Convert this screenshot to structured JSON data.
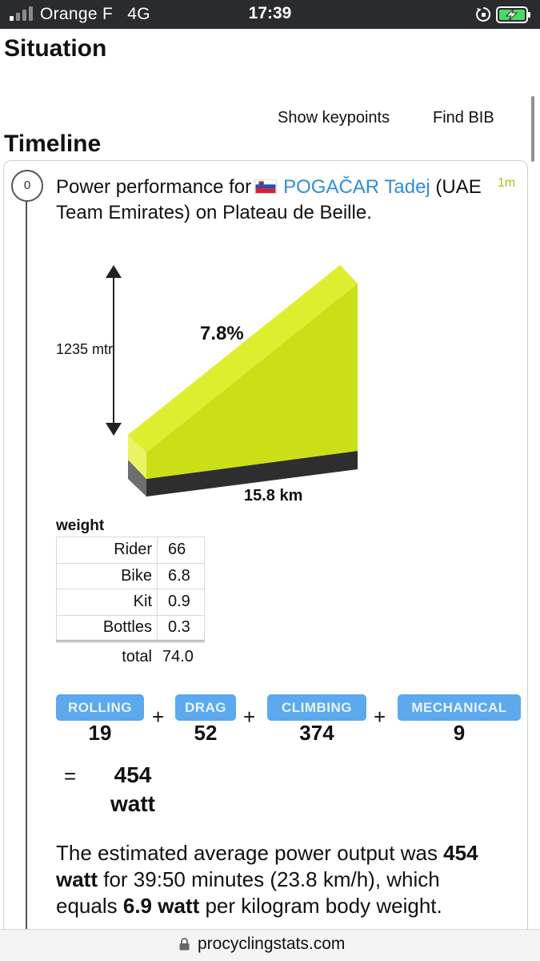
{
  "status_bar": {
    "carrier": "Orange F",
    "network": "4G",
    "time": "17:39",
    "signal_bars_on": 1,
    "signal_bars_total": 4,
    "battery_color": "#4cd964"
  },
  "page": {
    "section_title": "Situation",
    "links": {
      "show_keypoints": "Show keypoints",
      "find_bib": "Find BIB"
    },
    "timeline_title": "Timeline"
  },
  "timeline_entry": {
    "index": "0",
    "age": "1m",
    "intro_prefix": "Power performance for",
    "rider": "POGAČAR Tadej",
    "intro_suffix": "(UAE Team Emirates) on Plateau de Beille.",
    "flag": "slovenia-flag-icon",
    "climb": {
      "elevation_label": "1235 mtr",
      "gradient_label": "7.8%",
      "distance_label": "15.8 km",
      "colors": {
        "slope_top": "#ddee2e",
        "slope_side": "#cbdf16",
        "base": "#2e2e2e"
      }
    },
    "weight": {
      "heading": "weight",
      "rows": [
        {
          "label": "Rider",
          "value": "66"
        },
        {
          "label": "Bike",
          "value": "6.8"
        },
        {
          "label": "Kit",
          "value": "0.9"
        },
        {
          "label": "Bottles",
          "value": "0.3"
        }
      ],
      "total_label": "total",
      "total_value": "74.0"
    },
    "power": {
      "components": [
        {
          "label": "ROLLING",
          "value": "19"
        },
        {
          "label": "DRAG",
          "value": "52"
        },
        {
          "label": "CLIMBING",
          "value": "374"
        },
        {
          "label": "MECHANICAL",
          "value": "9"
        }
      ],
      "plus": "+",
      "equals": "=",
      "total_value": "454",
      "total_unit": "watt",
      "badge_color": "#5ca9ed"
    },
    "summary": {
      "s1": "The estimated average power output was",
      "b1": "454 watt",
      "s2": "for 39:50 minutes (23.8 km/h), which equals",
      "b2": "6.9 watt",
      "s3": "per kilogram body weight."
    }
  },
  "browser": {
    "domain": "procyclingstats.com"
  }
}
